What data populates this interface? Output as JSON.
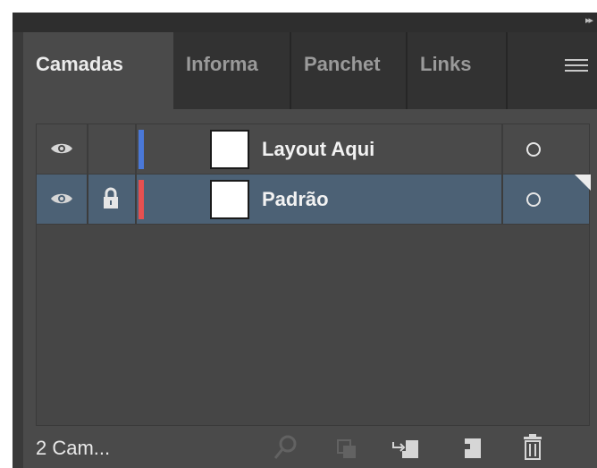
{
  "panel": {
    "tabs": [
      {
        "label": "Camadas",
        "active": true
      },
      {
        "label": "Informa",
        "active": false
      },
      {
        "label": "Panchet",
        "active": false
      },
      {
        "label": "Links",
        "active": false
      }
    ],
    "icons": {
      "collapse": "double-chevron-right-icon",
      "menu": "panel-menu-icon"
    }
  },
  "layers": [
    {
      "name": "Layout Aqui",
      "visible": true,
      "locked": false,
      "color": "#4a78d8",
      "selected": false
    },
    {
      "name": "Padrão",
      "visible": true,
      "locked": true,
      "color": "#e65050",
      "selected": true
    }
  ],
  "footer": {
    "count_label": "2 Cam...",
    "buttons": [
      "search-icon",
      "layers-merge-icon",
      "move-to-layer-icon",
      "new-layer-icon",
      "trash-icon"
    ]
  }
}
